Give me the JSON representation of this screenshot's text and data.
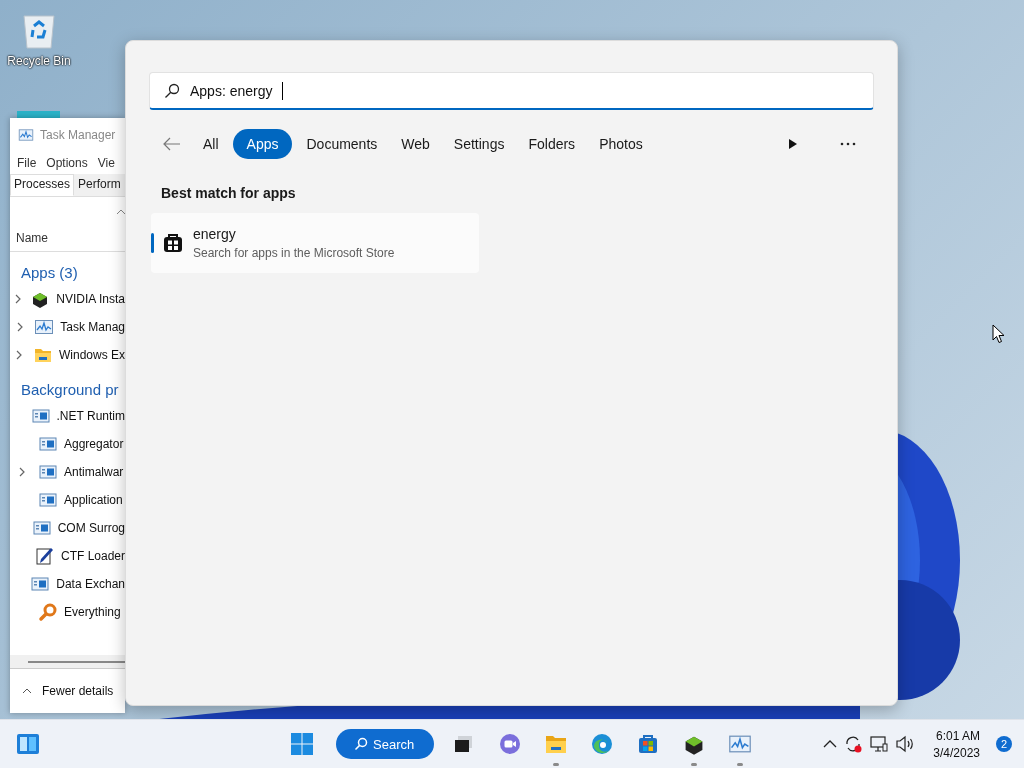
{
  "desktop": {
    "icons": [
      {
        "label": "Recycle Bin",
        "kind": "recycle"
      }
    ]
  },
  "task_manager": {
    "title": "Task Manager",
    "menu": [
      "File",
      "Options",
      "Vie"
    ],
    "tabs": [
      {
        "label": "Processes",
        "selected": true
      },
      {
        "label": "Perform",
        "selected": false
      }
    ],
    "column": "Name",
    "groups": [
      {
        "title": "Apps (3)",
        "rows": [
          {
            "name": "NVIDIA Insta",
            "expandable": true,
            "kind": "nvidia"
          },
          {
            "name": "Task Manag",
            "expandable": true,
            "kind": "taskmgr"
          },
          {
            "name": "Windows Ex",
            "expandable": true,
            "kind": "folder"
          }
        ]
      },
      {
        "title": "Background pr",
        "rows": [
          {
            "name": ".NET Runtim",
            "expandable": false,
            "kind": "service"
          },
          {
            "name": "Aggregator",
            "expandable": false,
            "kind": "service"
          },
          {
            "name": "Antimalwar",
            "expandable": true,
            "kind": "service"
          },
          {
            "name": "Application",
            "expandable": false,
            "kind": "service"
          },
          {
            "name": "COM Surrog",
            "expandable": false,
            "kind": "service"
          },
          {
            "name": "CTF Loader",
            "expandable": false,
            "kind": "ctf"
          },
          {
            "name": "Data Exchan",
            "expandable": false,
            "kind": "service"
          },
          {
            "name": "Everything",
            "expandable": false,
            "kind": "everything"
          }
        ]
      }
    ],
    "footer": "Fewer details"
  },
  "search": {
    "query": "Apps: energy",
    "filters": [
      {
        "label": "All",
        "selected": false
      },
      {
        "label": "Apps",
        "selected": true
      },
      {
        "label": "Documents",
        "selected": false
      },
      {
        "label": "Web",
        "selected": false
      },
      {
        "label": "Settings",
        "selected": false
      },
      {
        "label": "Folders",
        "selected": false
      },
      {
        "label": "Photos",
        "selected": false
      }
    ],
    "section": "Best match for apps",
    "results": [
      {
        "title": "energy",
        "subtitle": "Search for apps in the Microsoft Store",
        "selected": true
      }
    ]
  },
  "taskbar": {
    "search_label": "Search",
    "apps": [
      {
        "kind": "taskview",
        "running": false
      },
      {
        "kind": "chat",
        "running": false
      },
      {
        "kind": "explorer",
        "running": true
      },
      {
        "kind": "edge",
        "running": false
      },
      {
        "kind": "store",
        "running": false
      },
      {
        "kind": "nvidia",
        "running": true
      },
      {
        "kind": "taskmgr",
        "running": true
      }
    ],
    "time": "6:01 AM",
    "date": "3/4/2023",
    "notifications": "2"
  }
}
